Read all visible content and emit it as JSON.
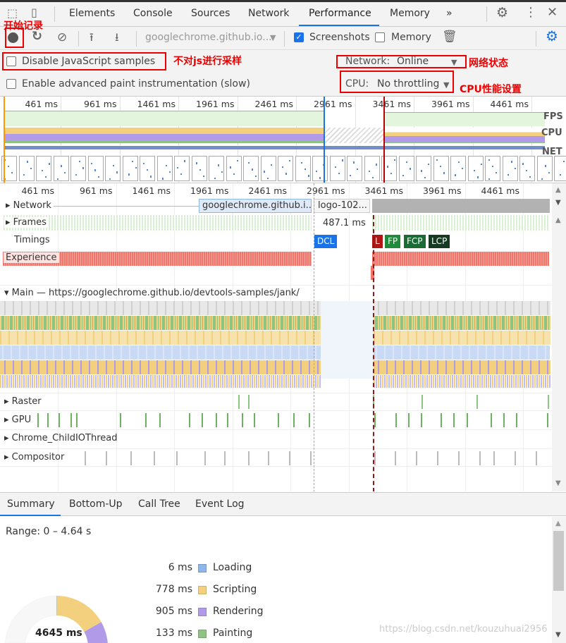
{
  "tabs": [
    "Elements",
    "Console",
    "Sources",
    "Network",
    "Performance",
    "Memory"
  ],
  "active_tab": "Performance",
  "more_tabs": "»",
  "toolbar": {
    "url": "googlechrome.github.io...",
    "screenshots_label": "Screenshots",
    "screenshots_checked": true,
    "memory_label": "Memory",
    "memory_checked": false
  },
  "settings": {
    "disable_js_label": "Disable JavaScript samples",
    "disable_js_checked": false,
    "advanced_paint_label": "Enable advanced paint instrumentation (slow)",
    "advanced_paint_checked": false,
    "network_label": "Network:",
    "network_value": "Online",
    "cpu_label": "CPU:",
    "cpu_value": "No throttling"
  },
  "annotations": {
    "record": "开始记录",
    "disable_js": "不对js进行采样",
    "network": "网络状态",
    "cpu": "CPU性能设置"
  },
  "overview": {
    "ticks": [
      "461 ms",
      "961 ms",
      "1461 ms",
      "1961 ms",
      "2461 ms",
      "2961 ms",
      "3461 ms",
      "3961 ms",
      "4461 ms"
    ],
    "fps": "FPS",
    "cpu": "CPU",
    "net": "NET"
  },
  "timeline": {
    "ticks": [
      "461 ms",
      "961 ms",
      "1461 ms",
      "1961 ms",
      "2461 ms",
      "2961 ms",
      "3461 ms",
      "3961 ms",
      "4461 ms"
    ],
    "network_label": "Network",
    "network_req1": "googlechrome.github.i...",
    "network_req2": "logo-102...",
    "frames_label": "Frames",
    "frame_gap": "487.1 ms",
    "timings_label": "Timings",
    "markers": {
      "dcl": "DCL",
      "l": "L",
      "fp": "FP",
      "fcp": "FCP",
      "lcp": "LCP"
    },
    "experience_label": "Experience",
    "main_label": "Main — https://googlechrome.github.io/devtools-samples/jank/",
    "raster_label": "Raster",
    "gpu_label": "GPU",
    "io_label": "Chrome_ChildIOThread",
    "compositor_label": "Compositor"
  },
  "bottom_tabs": [
    "Summary",
    "Bottom-Up",
    "Call Tree",
    "Event Log"
  ],
  "summary": {
    "range": "Range: 0 – 4.64 s",
    "total": "4645 ms",
    "items": [
      {
        "ms": "6 ms",
        "name": "Loading",
        "color": "#8fb6e8"
      },
      {
        "ms": "778 ms",
        "name": "Scripting",
        "color": "#f2d07e"
      },
      {
        "ms": "905 ms",
        "name": "Rendering",
        "color": "#b19be9"
      },
      {
        "ms": "133 ms",
        "name": "Painting",
        "color": "#8dc484"
      }
    ]
  },
  "watermark": "https://blog.csdn.net/kouzuhuai2956",
  "colors": {
    "accent": "#1a73e8",
    "annotation": "#e00000",
    "experience": "#f0766b"
  }
}
